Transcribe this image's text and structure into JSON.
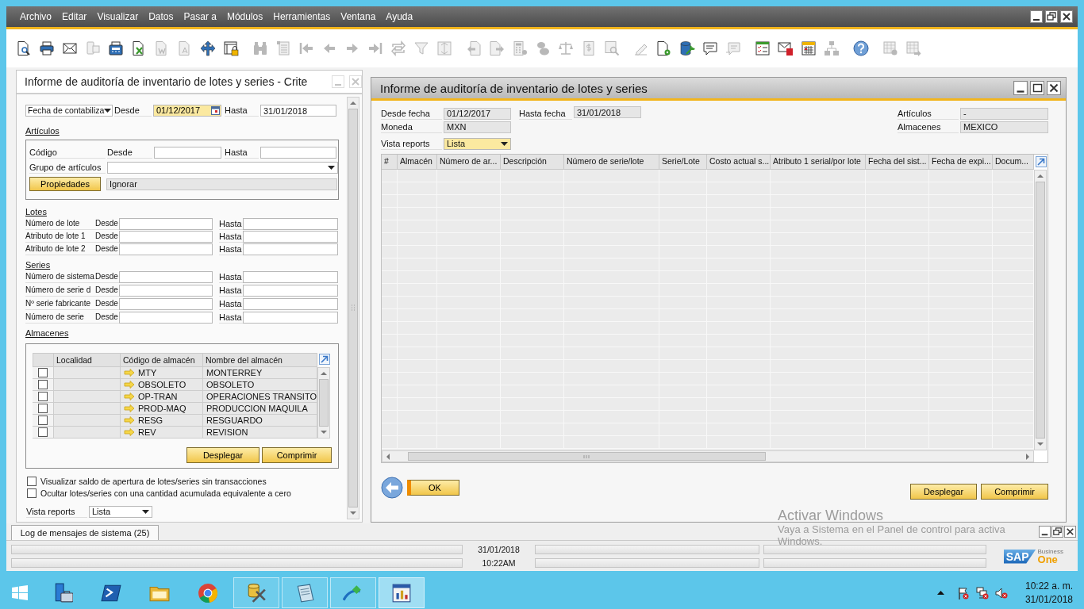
{
  "menu": [
    "Archivo",
    "Editar",
    "Visualizar",
    "Datos",
    "Pasar a",
    "Módulos",
    "Herramientas",
    "Ventana",
    "Ayuda"
  ],
  "toolbar": {
    "groups": [
      {
        "items": [
          {
            "kind": "magnifier-document",
            "disabled": false
          },
          {
            "kind": "printer",
            "disabled": false
          },
          {
            "kind": "envelope",
            "disabled": false
          },
          {
            "kind": "devices",
            "disabled": true
          },
          {
            "kind": "fax",
            "disabled": false
          },
          {
            "kind": "spreadsheet-document",
            "disabled": false
          },
          {
            "kind": "text-document",
            "disabled": true
          },
          {
            "kind": "letter-document",
            "disabled": true
          },
          {
            "kind": "cross-arrows",
            "disabled": false
          },
          {
            "kind": "window-lock",
            "disabled": false
          }
        ]
      },
      {
        "items": [
          {
            "kind": "binoculars",
            "disabled": true
          },
          {
            "kind": "list",
            "disabled": true
          },
          {
            "kind": "first",
            "disabled": true
          },
          {
            "kind": "previous",
            "disabled": true
          },
          {
            "kind": "next",
            "disabled": true
          },
          {
            "kind": "last",
            "disabled": true
          },
          {
            "kind": "swap",
            "disabled": true
          },
          {
            "kind": "filter",
            "disabled": true
          },
          {
            "kind": "sort",
            "disabled": true
          }
        ]
      },
      {
        "items": [
          {
            "kind": "document-left",
            "disabled": true
          },
          {
            "kind": "document-right",
            "disabled": true
          },
          {
            "kind": "calculator",
            "disabled": true
          },
          {
            "kind": "coins",
            "disabled": true
          },
          {
            "kind": "scale",
            "disabled": true
          },
          {
            "kind": "dollar-document",
            "disabled": true
          },
          {
            "kind": "document-magnifier",
            "disabled": true
          }
        ]
      },
      {
        "items": [
          {
            "kind": "pencil",
            "disabled": true
          },
          {
            "kind": "document-gear",
            "disabled": false
          },
          {
            "kind": "database-wrench",
            "disabled": false
          },
          {
            "kind": "chat",
            "disabled": false
          },
          {
            "kind": "chat-arrow",
            "disabled": true
          }
        ]
      },
      {
        "items": [
          {
            "kind": "checklist",
            "disabled": false
          },
          {
            "kind": "envelope-alert",
            "disabled": false
          },
          {
            "kind": "calendar",
            "disabled": false
          },
          {
            "kind": "hierarchy",
            "disabled": true
          }
        ]
      },
      {
        "items": [
          {
            "kind": "help",
            "disabled": false
          }
        ]
      },
      {
        "items": [
          {
            "kind": "grid-gear",
            "disabled": true
          },
          {
            "kind": "grid-arrow",
            "disabled": true
          }
        ]
      }
    ]
  },
  "criteria_window": {
    "title": "Informe de auditoría de inventario de lotes y series - Crite",
    "date_type": "Fecha de contabiliza",
    "date_range": {
      "from_label": "Desde",
      "from": {
        "value": "01/12/2017",
        "focused": true
      },
      "to_label": "Hasta",
      "to": {
        "value": "31/01/2018",
        "focused": false
      }
    },
    "items": {
      "heading": "Artículos",
      "code_label": "Código",
      "from_label": "Desde",
      "to_label": "Hasta",
      "group_label": "Grupo de artículos",
      "properties_button": "Propiedades",
      "properties_value": "Ignorar"
    },
    "batches": {
      "heading": "Lotes",
      "rows": [
        {
          "label": "Número de lote",
          "from_label": "Desde",
          "to_label": "Hasta"
        },
        {
          "label": "Atributo de lote 1",
          "from_label": "Desde",
          "to_label": "Hasta"
        },
        {
          "label": "Atributo de lote 2",
          "from_label": "Desde",
          "to_label": "Hasta"
        }
      ]
    },
    "serials": {
      "heading": "Series",
      "rows": [
        {
          "label": "Número de sistema",
          "from_label": "Desde",
          "to_label": "Hasta"
        },
        {
          "label": "Número de serie d",
          "from_label": "Desde",
          "to_label": "Hasta"
        },
        {
          "label": "Nº serie fabricante",
          "from_label": "Desde",
          "to_label": "Hasta"
        },
        {
          "label": "Número de serie",
          "from_label": "Desde",
          "to_label": "Hasta"
        }
      ]
    },
    "warehouses": {
      "heading": "Almacenes",
      "columns": [
        "Localidad",
        "Código de almacén",
        "Nombre del almacén"
      ],
      "rows": [
        {
          "checked": false,
          "code": "MTY",
          "name": "MONTERREY"
        },
        {
          "checked": false,
          "code": "OBSOLETO",
          "name": "OBSOLETO"
        },
        {
          "checked": false,
          "code": "OP-TRAN",
          "name": "OPERACIONES TRANSITO"
        },
        {
          "checked": false,
          "code": "PROD-MAQ",
          "name": "PRODUCCION MAQUILA"
        },
        {
          "checked": false,
          "code": "RESG",
          "name": "RESGUARDO"
        },
        {
          "checked": false,
          "code": "REV",
          "name": "REVISION"
        }
      ],
      "buttons": [
        "Desplegar",
        "Comprimir"
      ]
    },
    "options": [
      {
        "label": "Visualizar saldo de apertura de lotes/series sin transacciones",
        "checked": false
      },
      {
        "label": "Ocultar lotes/series con una cantidad acumulada equivalente a cero",
        "checked": false
      }
    ],
    "view": {
      "label": "Vista reports",
      "value": "Lista",
      "focused": false
    }
  },
  "report_window": {
    "title": "Informe de auditoría de inventario de lotes y series",
    "fields": {
      "from_date": {
        "label": "Desde fecha",
        "value": "01/12/2017"
      },
      "to_date": {
        "label": "Hasta fecha",
        "value": "31/01/2018"
      },
      "currency": {
        "label": "Moneda",
        "value": "MXN"
      },
      "items": {
        "label": "Artículos",
        "value": "-"
      },
      "warehouses": {
        "label": "Almacenes",
        "value": "MEXICO"
      }
    },
    "view": {
      "label": "Vista reports",
      "value": "Lista",
      "focused": true
    },
    "table": {
      "columns": [
        "#",
        "Almacén",
        "Número de ar...",
        "Descripción",
        "Número de serie/lote",
        "Serie/Lote",
        "Costo actual s...",
        "Atributo 1 serial/por lote",
        "Fecha del sist...",
        "Fecha de expi...",
        "Docum..."
      ]
    },
    "buttons": {
      "ok": "OK",
      "expand": "Desplegar",
      "collapse": "Comprimir"
    }
  },
  "log_tab": {
    "label": "Log de mensajes de sistema (25)"
  },
  "status_bar": {
    "date": "31/01/2018",
    "time": "10:22AM"
  },
  "logo": {
    "brand": "SAP",
    "line_1": "Business",
    "line_2": "One"
  },
  "activation_notice": {
    "title": "Activar Windows",
    "line_1": "Vaya a Sistema en el Panel de control para activa",
    "line_2": "Windows."
  },
  "taskbar": {
    "apps": [
      {
        "kind": "server-manager",
        "open": false,
        "selected": false
      },
      {
        "kind": "terminal",
        "open": false,
        "selected": false
      },
      {
        "kind": "folder",
        "open": false,
        "selected": false
      },
      {
        "kind": "round-logo",
        "open": false,
        "selected": false
      },
      {
        "kind": "database-tools",
        "open": true,
        "selected": false
      },
      {
        "kind": "notepad",
        "open": true,
        "selected": false
      },
      {
        "kind": "arrow-diamond",
        "open": true,
        "selected": false
      },
      {
        "kind": "report-chart",
        "open": true,
        "selected": true
      }
    ],
    "time": "10:22 a. m.",
    "date": "31/01/2018"
  }
}
